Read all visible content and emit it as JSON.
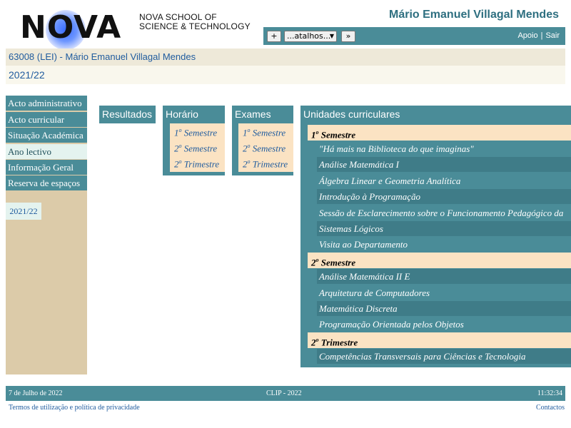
{
  "header": {
    "logo_word": "NOVA",
    "logo_sub_line1": "NOVA SCHOOL OF",
    "logo_sub_line2": "SCIENCE & TECHNOLOGY",
    "user_name": "Mário Emanuel Villagal Mendes",
    "plus_label": "+",
    "shortcuts_selected": "...atalhos...",
    "go_label": "»",
    "links": {
      "support": "Apoio",
      "logout": "Sair"
    }
  },
  "breadcrumb": {
    "student": "63008 (LEI) - Mário Emanuel Villagal Mendes",
    "year": "2021/22"
  },
  "sidebar": {
    "items": [
      {
        "label": "Acto administrativo"
      },
      {
        "label": "Acto curricular"
      },
      {
        "label": "Situação Académica"
      },
      {
        "label": "Ano lectivo"
      },
      {
        "label": "Informação Geral"
      },
      {
        "label": "Reserva de espaços"
      }
    ],
    "active_index": 3,
    "year_chip": "2021/22"
  },
  "panels": {
    "results": {
      "title": "Resultados"
    },
    "schedule": {
      "title": "Horário",
      "links": [
        {
          "num": "1",
          "ord": "o",
          "text": "Semestre"
        },
        {
          "num": "2",
          "ord": "o",
          "text": "Semestre"
        },
        {
          "num": "2",
          "ord": "o",
          "text": "Trimestre"
        }
      ]
    },
    "exams": {
      "title": "Exames",
      "links": [
        {
          "num": "1",
          "ord": "o",
          "text": "Semestre"
        },
        {
          "num": "2",
          "ord": "o",
          "text": "Semestre"
        },
        {
          "num": "2",
          "ord": "o",
          "text": "Trimestre"
        }
      ]
    },
    "units": {
      "title": "Unidades curriculares",
      "groups": [
        {
          "num": "1",
          "ord": "o",
          "text": "Semestre",
          "courses": [
            "\"Há mais na Biblioteca do que imaginas\"",
            "Análise Matemática I",
            "Álgebra Linear e Geometria Analítica",
            "Introdução à Programação",
            "Sessão de Esclarecimento sobre o Funcionamento Pedagógico da",
            "Sistemas Lógicos",
            "Visita ao Departamento"
          ]
        },
        {
          "num": "2",
          "ord": "o",
          "text": "Semestre",
          "courses": [
            "Análise Matemática II E",
            "Arquitetura de Computadores",
            "Matemática Discreta",
            "Programação Orientada pelos Objetos"
          ]
        },
        {
          "num": "2",
          "ord": "o",
          "text": "Trimestre",
          "courses": [
            "Competências Transversais para Ciências e Tecnologia"
          ]
        }
      ]
    }
  },
  "footer": {
    "date": "7 de Julho de 2022",
    "center": "CLIP - 2022",
    "time": "11:32:34",
    "terms": "Termos de utilização e política de privacidade",
    "contacts": "Contactos"
  },
  "colors": {
    "teal": "#4a8c98",
    "teal_dark": "#3f7c88",
    "peach": "#fbe3c3",
    "sidebar_bg": "#dccba9",
    "link_blue": "#1f5b9e",
    "active_bg": "#e4f3ef"
  }
}
